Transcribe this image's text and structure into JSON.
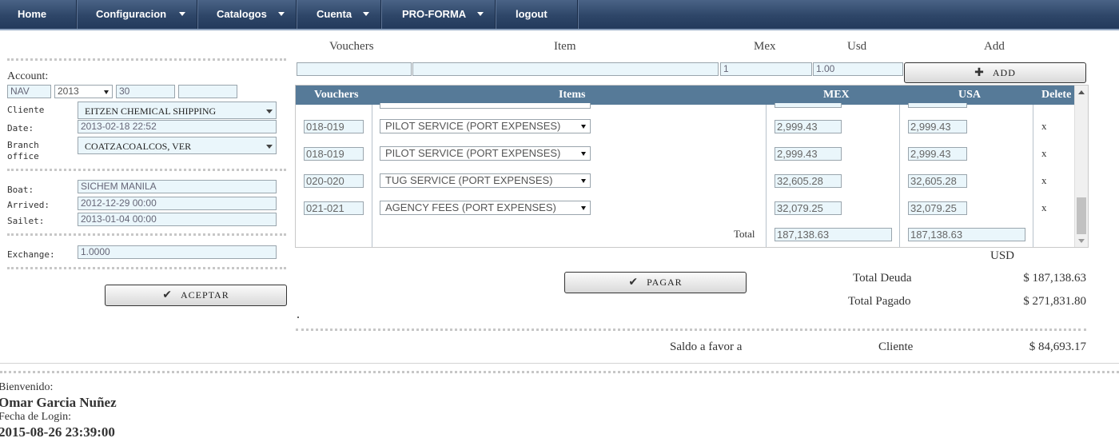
{
  "nav": {
    "items": [
      {
        "label": "Home"
      },
      {
        "label": "Configuracion"
      },
      {
        "label": "Catalogos"
      },
      {
        "label": "Cuenta"
      },
      {
        "label": "PRO-FORMA"
      },
      {
        "label": "logout"
      }
    ]
  },
  "account": {
    "label": "Account:",
    "prefix": "NAV",
    "year": "2013",
    "number": "30",
    "extra": ""
  },
  "form": {
    "cliente_label": "Cliente",
    "cliente_value": "EITZEN CHEMICAL SHIPPING",
    "date_label": "Date:",
    "date_value": "2013-02-18 22:52",
    "branch_label_1": "Branch",
    "branch_label_2": "office",
    "branch_value": "COATZACOALCOS, VER",
    "boat_label": "Boat:",
    "boat_value": "SICHEM MANILA",
    "arrived_label": "Arrived:",
    "arrived_value": "2012-12-29 00:00",
    "sailet_label": "Sailet:",
    "sailet_value": "2013-01-04 00:00",
    "exchange_label": "Exchange:",
    "exchange_value": "1.0000",
    "accept_label": "ACEPTAR"
  },
  "add_row": {
    "vouchers_header": "Vouchers",
    "item_header": "Item",
    "mex_header": "Mex",
    "usd_header": "Usd",
    "add_header": "Add",
    "vouchers_value": "",
    "item_value": "",
    "mex_value": "1",
    "usd_value": "1.00",
    "add_label": "ADD"
  },
  "table": {
    "headers": {
      "vouchers": "Vouchers",
      "items": "Items",
      "mex": "MEX",
      "usa": "USA",
      "delete": "Delete"
    },
    "rows": [
      {
        "voucher": "018-019",
        "item": "PILOT SERVICE (PORT EXPENSES)",
        "mex": "2,999.43",
        "usa": "2,999.43",
        "delete": "x"
      },
      {
        "voucher": "018-019",
        "item": "PILOT SERVICE (PORT EXPENSES)",
        "mex": "2,999.43",
        "usa": "2,999.43",
        "delete": "x"
      },
      {
        "voucher": "020-020",
        "item": "TUG SERVICE (PORT EXPENSES)",
        "mex": "32,605.28",
        "usa": "32,605.28",
        "delete": "x"
      },
      {
        "voucher": "021-021",
        "item": "AGENCY FEES (PORT EXPENSES)",
        "mex": "32,079.25",
        "usa": "32,079.25",
        "delete": "x"
      }
    ],
    "total_label": "Total",
    "total_mex": "187,138.63",
    "total_usa": "187,138.63"
  },
  "summary": {
    "currency": "USD",
    "pay_label": "PAGAR",
    "deuda_label": "Total Deuda",
    "deuda_value": "$ 187,138.63",
    "pagado_label": "Total Pagado",
    "pagado_value": "$ 271,831.80",
    "saldo_label": "Saldo a favor a",
    "saldo_party": "Cliente",
    "saldo_value": "$ 84,693.17"
  },
  "footer": {
    "welcome_label": "Bienvenido:",
    "user_name": "Omar Garcia Nuñez",
    "login_label": "Fecha de Login:",
    "login_date": "2015-08-26 23:39:00"
  }
}
